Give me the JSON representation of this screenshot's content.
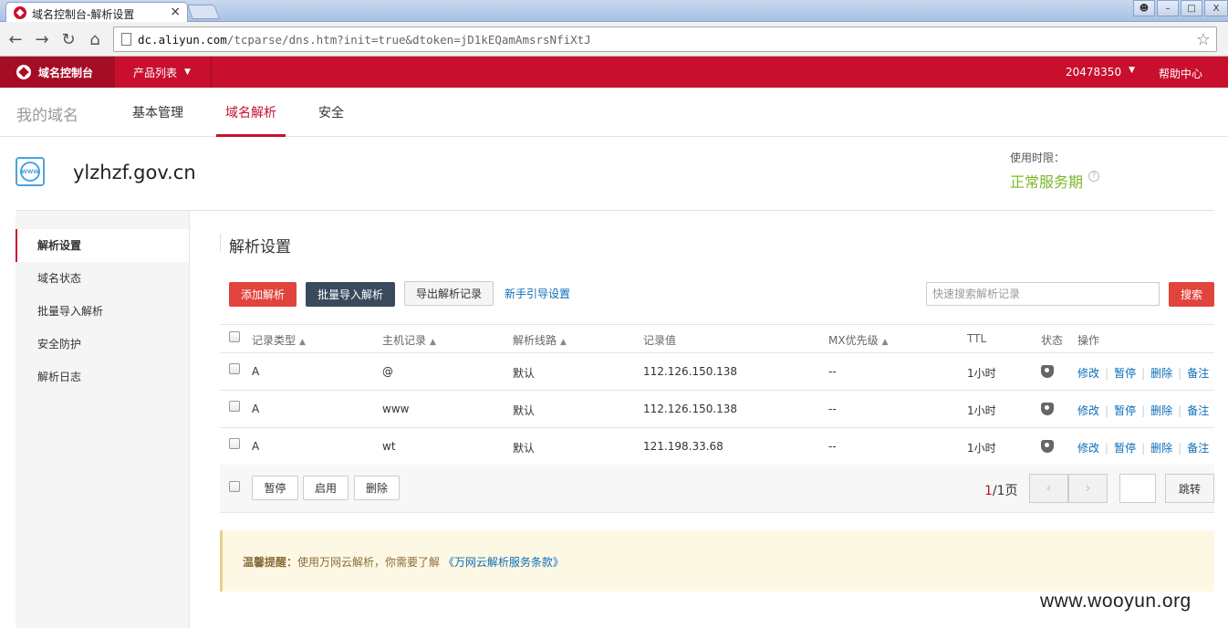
{
  "browser": {
    "tab_title": "域名控制台-解析设置",
    "tab_close": "×",
    "url_host": "dc.aliyun.com",
    "url_path": "/tcparse/dns.htm?init=true&dtoken=jD1kEQamAmsrsNfiXtJ",
    "win_min": "–",
    "win_max": "□",
    "win_close": "X"
  },
  "topbar": {
    "brand": "域名控制台",
    "product_list": "产品列表",
    "account_id": "20478350",
    "help": "帮助中心"
  },
  "domain_nav": {
    "my_domains": "我的域名",
    "tabs": [
      "基本管理",
      "域名解析",
      "安全"
    ],
    "active_tab": "域名解析"
  },
  "domain": {
    "name": "ylzhzf.gov.cn",
    "usage_label": "使用时限：",
    "service_status": "正常服务期",
    "service_status_color": "#7ab829"
  },
  "sidebar": {
    "items": [
      "解析设置",
      "域名状态",
      "批量导入解析",
      "安全防护",
      "解析日志"
    ],
    "active": "解析设置"
  },
  "main": {
    "title": "解析设置",
    "add_button": "添加解析",
    "batch_import_button": "批量导入解析",
    "export_button": "导出解析记录",
    "guide_link": "新手引导设置",
    "search_placeholder": "快速搜索解析记录",
    "search_button": "搜索"
  },
  "table": {
    "headers": {
      "type": "记录类型",
      "host": "主机记录",
      "line": "解析线路",
      "value": "记录值",
      "mx": "MX优先级",
      "ttl": "TTL",
      "status": "状态",
      "ops": "操作"
    },
    "rows": [
      {
        "type": "A",
        "host": "@",
        "line": "默认",
        "value": "112.126.150.138",
        "mx": "--",
        "ttl": "1小时"
      },
      {
        "type": "A",
        "host": "www",
        "line": "默认",
        "value": "112.126.150.138",
        "mx": "--",
        "ttl": "1小时"
      },
      {
        "type": "A",
        "host": "wt",
        "line": "默认",
        "value": "121.198.33.68",
        "mx": "--",
        "ttl": "1小时"
      }
    ],
    "ops": {
      "edit": "修改",
      "pause": "暂停",
      "delete": "删除",
      "note": "备注",
      "sep": "|"
    },
    "footer": {
      "pause": "暂停",
      "enable": "启用",
      "delete": "删除",
      "page_current": "1",
      "page_total": "/1页",
      "prev": "‹",
      "next": "›",
      "jump": "跳转"
    }
  },
  "notice": {
    "label": "温馨提醒：",
    "text": "使用万网云解析，你需要了解",
    "link": "《万网云解析服务条款》"
  },
  "watermark": "www.wooyun.org",
  "colors": {
    "brand_red": "#c8102e",
    "button_red": "#e0443c",
    "button_dark": "#394a5c",
    "link_blue": "#0b6db8"
  }
}
